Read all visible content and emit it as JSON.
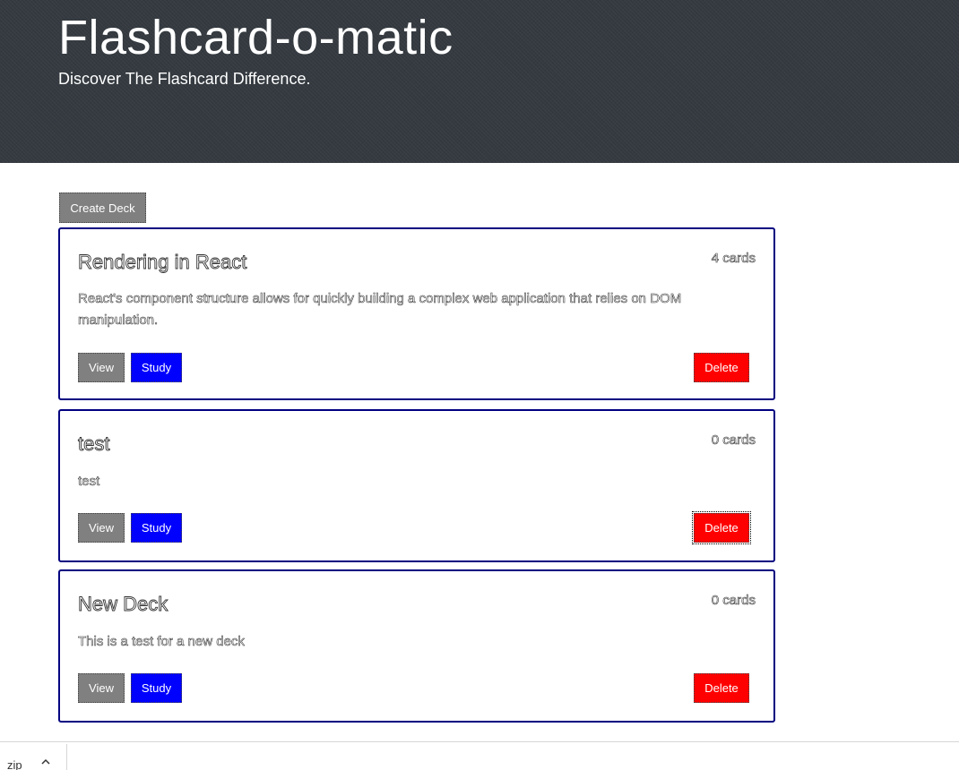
{
  "header": {
    "title": "Flashcard-o-matic",
    "subtitle": "Discover The Flashcard Difference."
  },
  "toolbar": {
    "create_label": "Create Deck"
  },
  "decks": [
    {
      "name": "Rendering in React",
      "count": "4 cards",
      "description": "React's component structure allows for quickly building a complex web application that relies on DOM manipulation.",
      "view_label": "View",
      "study_label": "Study",
      "delete_label": "Delete"
    },
    {
      "name": "test",
      "count": "0 cards",
      "description": "test",
      "view_label": "View",
      "study_label": "Study",
      "delete_label": "Delete"
    },
    {
      "name": "New Deck",
      "count": "0 cards",
      "description": "This is a test for a new deck",
      "view_label": "View",
      "study_label": "Study",
      "delete_label": "Delete"
    }
  ],
  "download_bar": {
    "file_label": "zip",
    "chevron_icon": "chevron-up-icon"
  },
  "colors": {
    "header_bg": "#343a40",
    "deck_border": "#000080",
    "secondary_button": "#808080",
    "study_button": "#0000ff",
    "delete_button": "#ff0000"
  }
}
